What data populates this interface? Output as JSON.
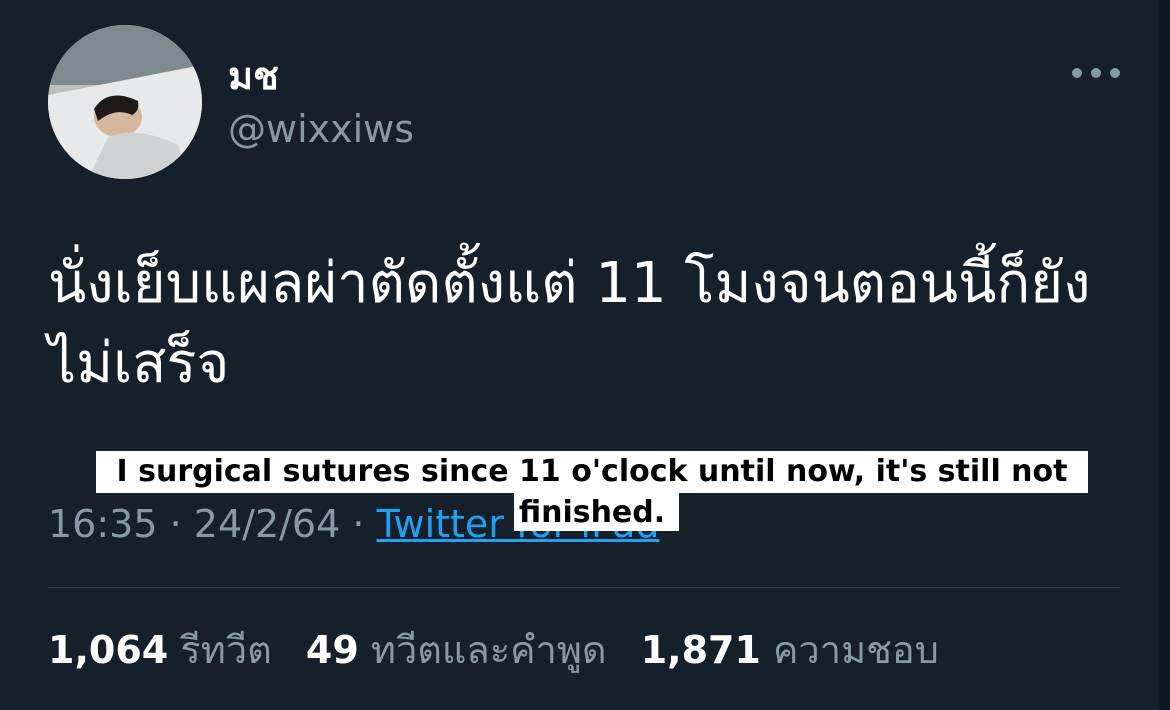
{
  "user": {
    "display_name": "มช",
    "handle": "@wixxiws",
    "avatar_icon": "profile-photo-icon"
  },
  "menu_icon": "more-horizontal-icon",
  "tweet": {
    "text": "นั่งเย็บแผลผ่าตัดตั้งแต่ 11 โมงจนตอนนี้ก็ยังไม่เสร็จ"
  },
  "meta": {
    "time": "16:35",
    "separator": "·",
    "date": "24/2/64",
    "source": "Twitter for iPad"
  },
  "caption": {
    "text": "I surgical sutures since 11 o'clock until now, it's still not finished."
  },
  "stats": {
    "retweets_count": "1,064",
    "retweets_label": "รีทวีต",
    "quotes_count": "49",
    "quotes_label": "ทวีตและคำพูด",
    "likes_count": "1,871",
    "likes_label": "ความชอบ"
  },
  "colors": {
    "background": "#15202b",
    "secondary_text": "#8899a6",
    "link": "#1da1f2",
    "divider": "#38444d"
  }
}
